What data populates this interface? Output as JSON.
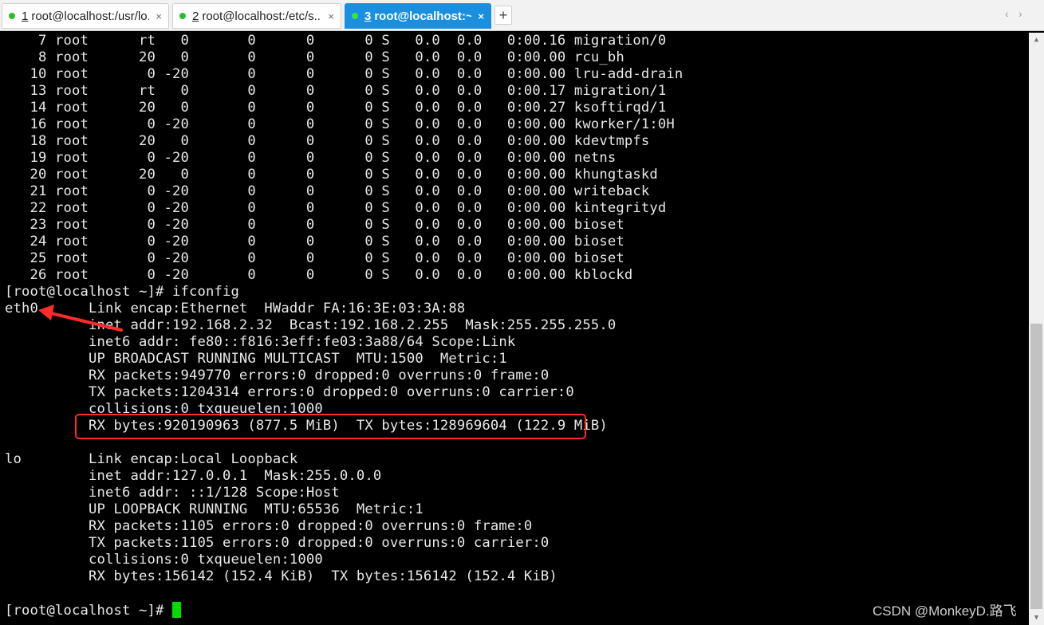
{
  "tabs": [
    {
      "number": "1",
      "title": "root@localhost:/usr/lo...",
      "close": "×",
      "active": false
    },
    {
      "number": "2",
      "title": "root@localhost:/etc/s...",
      "close": "×",
      "active": false
    },
    {
      "number": "3",
      "title": "root@localhost:~",
      "close": "×",
      "active": true
    }
  ],
  "new_tab_label": "+",
  "nav_prev": "‹",
  "nav_next": "›",
  "terminal_lines": [
    "    7 root      rt   0       0      0      0 S   0.0  0.0   0:00.16 migration/0",
    "    8 root      20   0       0      0      0 S   0.0  0.0   0:00.00 rcu_bh",
    "   10 root       0 -20       0      0      0 S   0.0  0.0   0:00.00 lru-add-drain",
    "   13 root      rt   0       0      0      0 S   0.0  0.0   0:00.17 migration/1",
    "   14 root      20   0       0      0      0 S   0.0  0.0   0:00.27 ksoftirqd/1",
    "   16 root       0 -20       0      0      0 S   0.0  0.0   0:00.00 kworker/1:0H",
    "   18 root      20   0       0      0      0 S   0.0  0.0   0:00.00 kdevtmpfs",
    "   19 root       0 -20       0      0      0 S   0.0  0.0   0:00.00 netns",
    "   20 root      20   0       0      0      0 S   0.0  0.0   0:00.00 khungtaskd",
    "   21 root       0 -20       0      0      0 S   0.0  0.0   0:00.00 writeback",
    "   22 root       0 -20       0      0      0 S   0.0  0.0   0:00.00 kintegrityd",
    "   23 root       0 -20       0      0      0 S   0.0  0.0   0:00.00 bioset",
    "   24 root       0 -20       0      0      0 S   0.0  0.0   0:00.00 bioset",
    "   25 root       0 -20       0      0      0 S   0.0  0.0   0:00.00 bioset",
    "   26 root       0 -20       0      0      0 S   0.0  0.0   0:00.00 kblockd",
    "[root@localhost ~]# ifconfig",
    "eth0      Link encap:Ethernet  HWaddr FA:16:3E:03:3A:88",
    "          inet addr:192.168.2.32  Bcast:192.168.2.255  Mask:255.255.255.0",
    "          inet6 addr: fe80::f816:3eff:fe03:3a88/64 Scope:Link",
    "          UP BROADCAST RUNNING MULTICAST  MTU:1500  Metric:1",
    "          RX packets:949770 errors:0 dropped:0 overruns:0 frame:0",
    "          TX packets:1204314 errors:0 dropped:0 overruns:0 carrier:0",
    "          collisions:0 txqueuelen:1000",
    "          RX bytes:920190963 (877.5 MiB)  TX bytes:128969604 (122.9 MiB)",
    "",
    "lo        Link encap:Local Loopback",
    "          inet addr:127.0.0.1  Mask:255.0.0.0",
    "          inet6 addr: ::1/128 Scope:Host",
    "          UP LOOPBACK RUNNING  MTU:65536  Metric:1",
    "          RX packets:1105 errors:0 dropped:0 overruns:0 frame:0",
    "          TX packets:1105 errors:0 dropped:0 overruns:0 carrier:0",
    "          collisions:0 txqueuelen:1000",
    "          RX bytes:156142 (152.4 KiB)  TX bytes:156142 (152.4 KiB)",
    ""
  ],
  "prompt": "[root@localhost ~]# ",
  "watermark": "CSDN @MonkeyD.路飞",
  "colors": {
    "terminal_bg": "#000000",
    "terminal_fg": "#e8e8e8",
    "cursor": "#00e000",
    "active_tab": "#1a8fe0",
    "annotation": "#ff2a2a"
  }
}
